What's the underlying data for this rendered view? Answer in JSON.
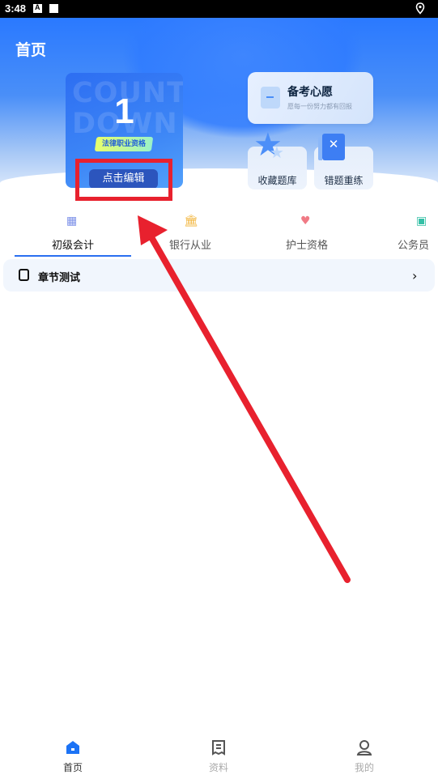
{
  "status_bar": {
    "time": "3:48"
  },
  "header": {
    "title": "首页"
  },
  "countdown": {
    "bg_text_line1": "COUNT",
    "bg_text_line2": "DOWN",
    "days": "1",
    "exam": "法律职业资格",
    "edit_label": "点击编辑"
  },
  "wish": {
    "title": "备考心愿",
    "subtitle": "愿每一份努力都有回报"
  },
  "tiles": {
    "favorites": "收藏题库",
    "mistakes": "错题重练"
  },
  "categories": [
    {
      "label": "初级会计",
      "active": true
    },
    {
      "label": "银行从业",
      "active": false
    },
    {
      "label": "护士资格",
      "active": false
    },
    {
      "label": "公务员",
      "active": false
    }
  ],
  "chapter": {
    "label": "章节测试"
  },
  "bottom_nav": [
    {
      "label": "首页",
      "active": true
    },
    {
      "label": "资料",
      "active": false
    },
    {
      "label": "我的",
      "active": false
    }
  ],
  "colors": {
    "accent": "#2a6ff0",
    "annotation_red": "#e8212e"
  }
}
